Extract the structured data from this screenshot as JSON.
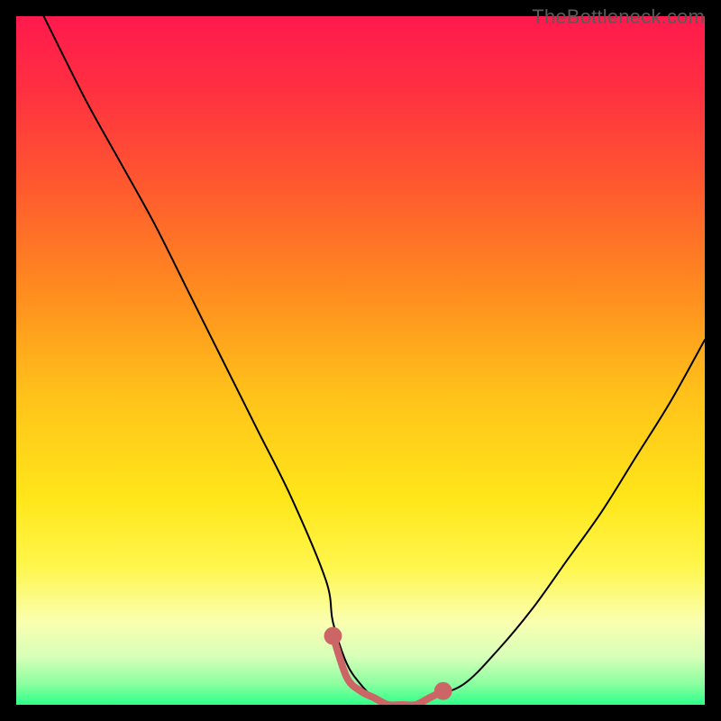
{
  "watermark": "TheBottleneck.com",
  "chart_data": {
    "type": "line",
    "title": "",
    "xlabel": "",
    "ylabel": "",
    "xlim": [
      0,
      100
    ],
    "ylim": [
      0,
      100
    ],
    "series": [
      {
        "name": "bottleneck-curve",
        "color": "#000000",
        "x": [
          4,
          10,
          15,
          20,
          25,
          30,
          35,
          40,
          45,
          46,
          48,
          50,
          52,
          54,
          56,
          58,
          60,
          65,
          70,
          75,
          80,
          85,
          90,
          95,
          100
        ],
        "y": [
          100,
          88,
          79,
          70,
          60,
          50,
          40,
          30,
          18,
          12,
          6,
          3,
          1,
          0,
          0,
          0,
          1,
          3,
          8,
          14,
          21,
          28,
          36,
          44,
          53
        ]
      },
      {
        "name": "optimal-range-marker",
        "color": "#cc6666",
        "x": [
          46,
          48,
          50,
          52,
          54,
          56,
          58,
          60,
          62
        ],
        "y": [
          10,
          4,
          2,
          1,
          0,
          0,
          0,
          1,
          2
        ]
      }
    ],
    "gradient_stops": [
      {
        "offset": 0.0,
        "color": "#ff1a4d"
      },
      {
        "offset": 0.1,
        "color": "#ff2e42"
      },
      {
        "offset": 0.25,
        "color": "#ff5a2e"
      },
      {
        "offset": 0.4,
        "color": "#ff8c1f"
      },
      {
        "offset": 0.55,
        "color": "#ffc21a"
      },
      {
        "offset": 0.7,
        "color": "#ffe61a"
      },
      {
        "offset": 0.8,
        "color": "#fff64d"
      },
      {
        "offset": 0.88,
        "color": "#faffb0"
      },
      {
        "offset": 0.93,
        "color": "#d7ffb8"
      },
      {
        "offset": 0.97,
        "color": "#8affa0"
      },
      {
        "offset": 1.0,
        "color": "#2eff88"
      }
    ]
  }
}
